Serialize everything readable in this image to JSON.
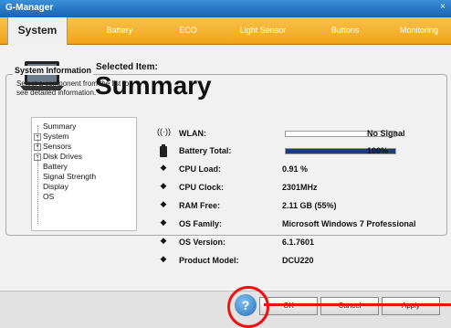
{
  "window": {
    "title": "G-Manager",
    "close": "×"
  },
  "tabs": [
    {
      "label": "System",
      "active": true
    },
    {
      "label": "Battery"
    },
    {
      "label": "ECO"
    },
    {
      "label": "Light Sensor"
    },
    {
      "label": "Buttons"
    },
    {
      "label": "Monitoring"
    }
  ],
  "selected": {
    "label": "Selected Item:",
    "title": "Summary"
  },
  "system_info": {
    "title": "System Information",
    "hint": "Select a component from the list to see detailed information.",
    "tree": [
      "Summary",
      "System",
      "Sensors",
      "Disk Drives",
      "Battery",
      "Signal Strength",
      "Display",
      "OS"
    ]
  },
  "rows": [
    {
      "icon": "wifi-icon",
      "label": "WLAN:",
      "value": "No Signal",
      "bar": 0.0
    },
    {
      "icon": "battery-icon",
      "label": "Battery Total:",
      "value": "100%",
      "bar": 1.0
    },
    {
      "icon": "chip-icon",
      "label": "CPU Load:",
      "value": "0.91 %"
    },
    {
      "icon": "chip-icon",
      "label": "CPU Clock:",
      "value": "2301MHz"
    },
    {
      "icon": "chip-icon",
      "label": "RAM Free:",
      "value": "2.11 GB (55%)"
    },
    {
      "icon": "chip-icon",
      "label": "OS Family:",
      "value": "Microsoft Windows 7 Professional"
    },
    {
      "icon": "chip-icon",
      "label": "OS Version:",
      "value": "6.1.7601"
    },
    {
      "icon": "chip-icon",
      "label": "Product Model:",
      "value": "DCU220"
    }
  ],
  "footer": {
    "help": "?",
    "ok": "OK",
    "cancel": "Cancel",
    "apply": "Apply"
  },
  "colors": {
    "tab_bar": "#f0a41a",
    "annotation": "#e11111",
    "progress": "#1b3b8a"
  }
}
